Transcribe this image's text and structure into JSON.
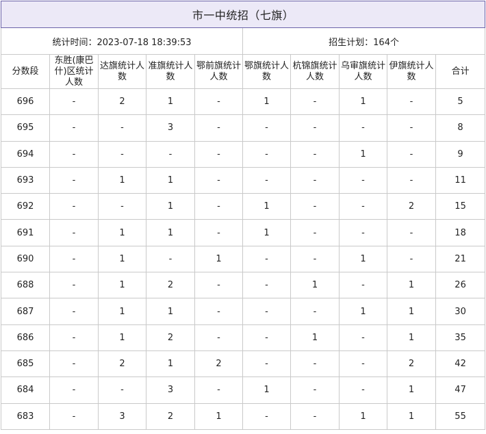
{
  "title": "市一中统招（七旗）",
  "meta": {
    "time_label": "统计时间：",
    "time_value": "2023-07-18 18:39:53",
    "plan_label": "招生计划：",
    "plan_value": "164个"
  },
  "columns": [
    "分数段",
    "东胜(康巴什)区统计人数",
    "达旗统计人数",
    "准旗统计人数",
    "鄂前旗统计人数",
    "鄂旗统计人数",
    "杭锦旗统计人数",
    "乌审旗统计人数",
    "伊旗统计人数",
    "合计"
  ],
  "rows": [
    [
      "696",
      "-",
      "2",
      "1",
      "-",
      "1",
      "-",
      "1",
      "-",
      "5"
    ],
    [
      "695",
      "-",
      "-",
      "3",
      "-",
      "-",
      "-",
      "-",
      "-",
      "8"
    ],
    [
      "694",
      "-",
      "-",
      "-",
      "-",
      "-",
      "-",
      "1",
      "-",
      "9"
    ],
    [
      "693",
      "-",
      "1",
      "1",
      "-",
      "-",
      "-",
      "-",
      "-",
      "11"
    ],
    [
      "692",
      "-",
      "-",
      "1",
      "-",
      "1",
      "-",
      "-",
      "2",
      "15"
    ],
    [
      "691",
      "-",
      "1",
      "1",
      "-",
      "1",
      "-",
      "-",
      "-",
      "18"
    ],
    [
      "690",
      "-",
      "1",
      "-",
      "1",
      "-",
      "-",
      "1",
      "-",
      "21"
    ],
    [
      "688",
      "-",
      "1",
      "2",
      "-",
      "-",
      "1",
      "-",
      "1",
      "26"
    ],
    [
      "687",
      "-",
      "1",
      "1",
      "-",
      "-",
      "-",
      "1",
      "1",
      "30"
    ],
    [
      "686",
      "-",
      "1",
      "2",
      "-",
      "-",
      "1",
      "-",
      "1",
      "35"
    ],
    [
      "685",
      "-",
      "2",
      "1",
      "2",
      "-",
      "-",
      "-",
      "2",
      "42"
    ],
    [
      "684",
      "-",
      "-",
      "3",
      "-",
      "1",
      "-",
      "-",
      "1",
      "47"
    ],
    [
      "683",
      "-",
      "3",
      "2",
      "1",
      "-",
      "-",
      "1",
      "1",
      "55"
    ]
  ]
}
